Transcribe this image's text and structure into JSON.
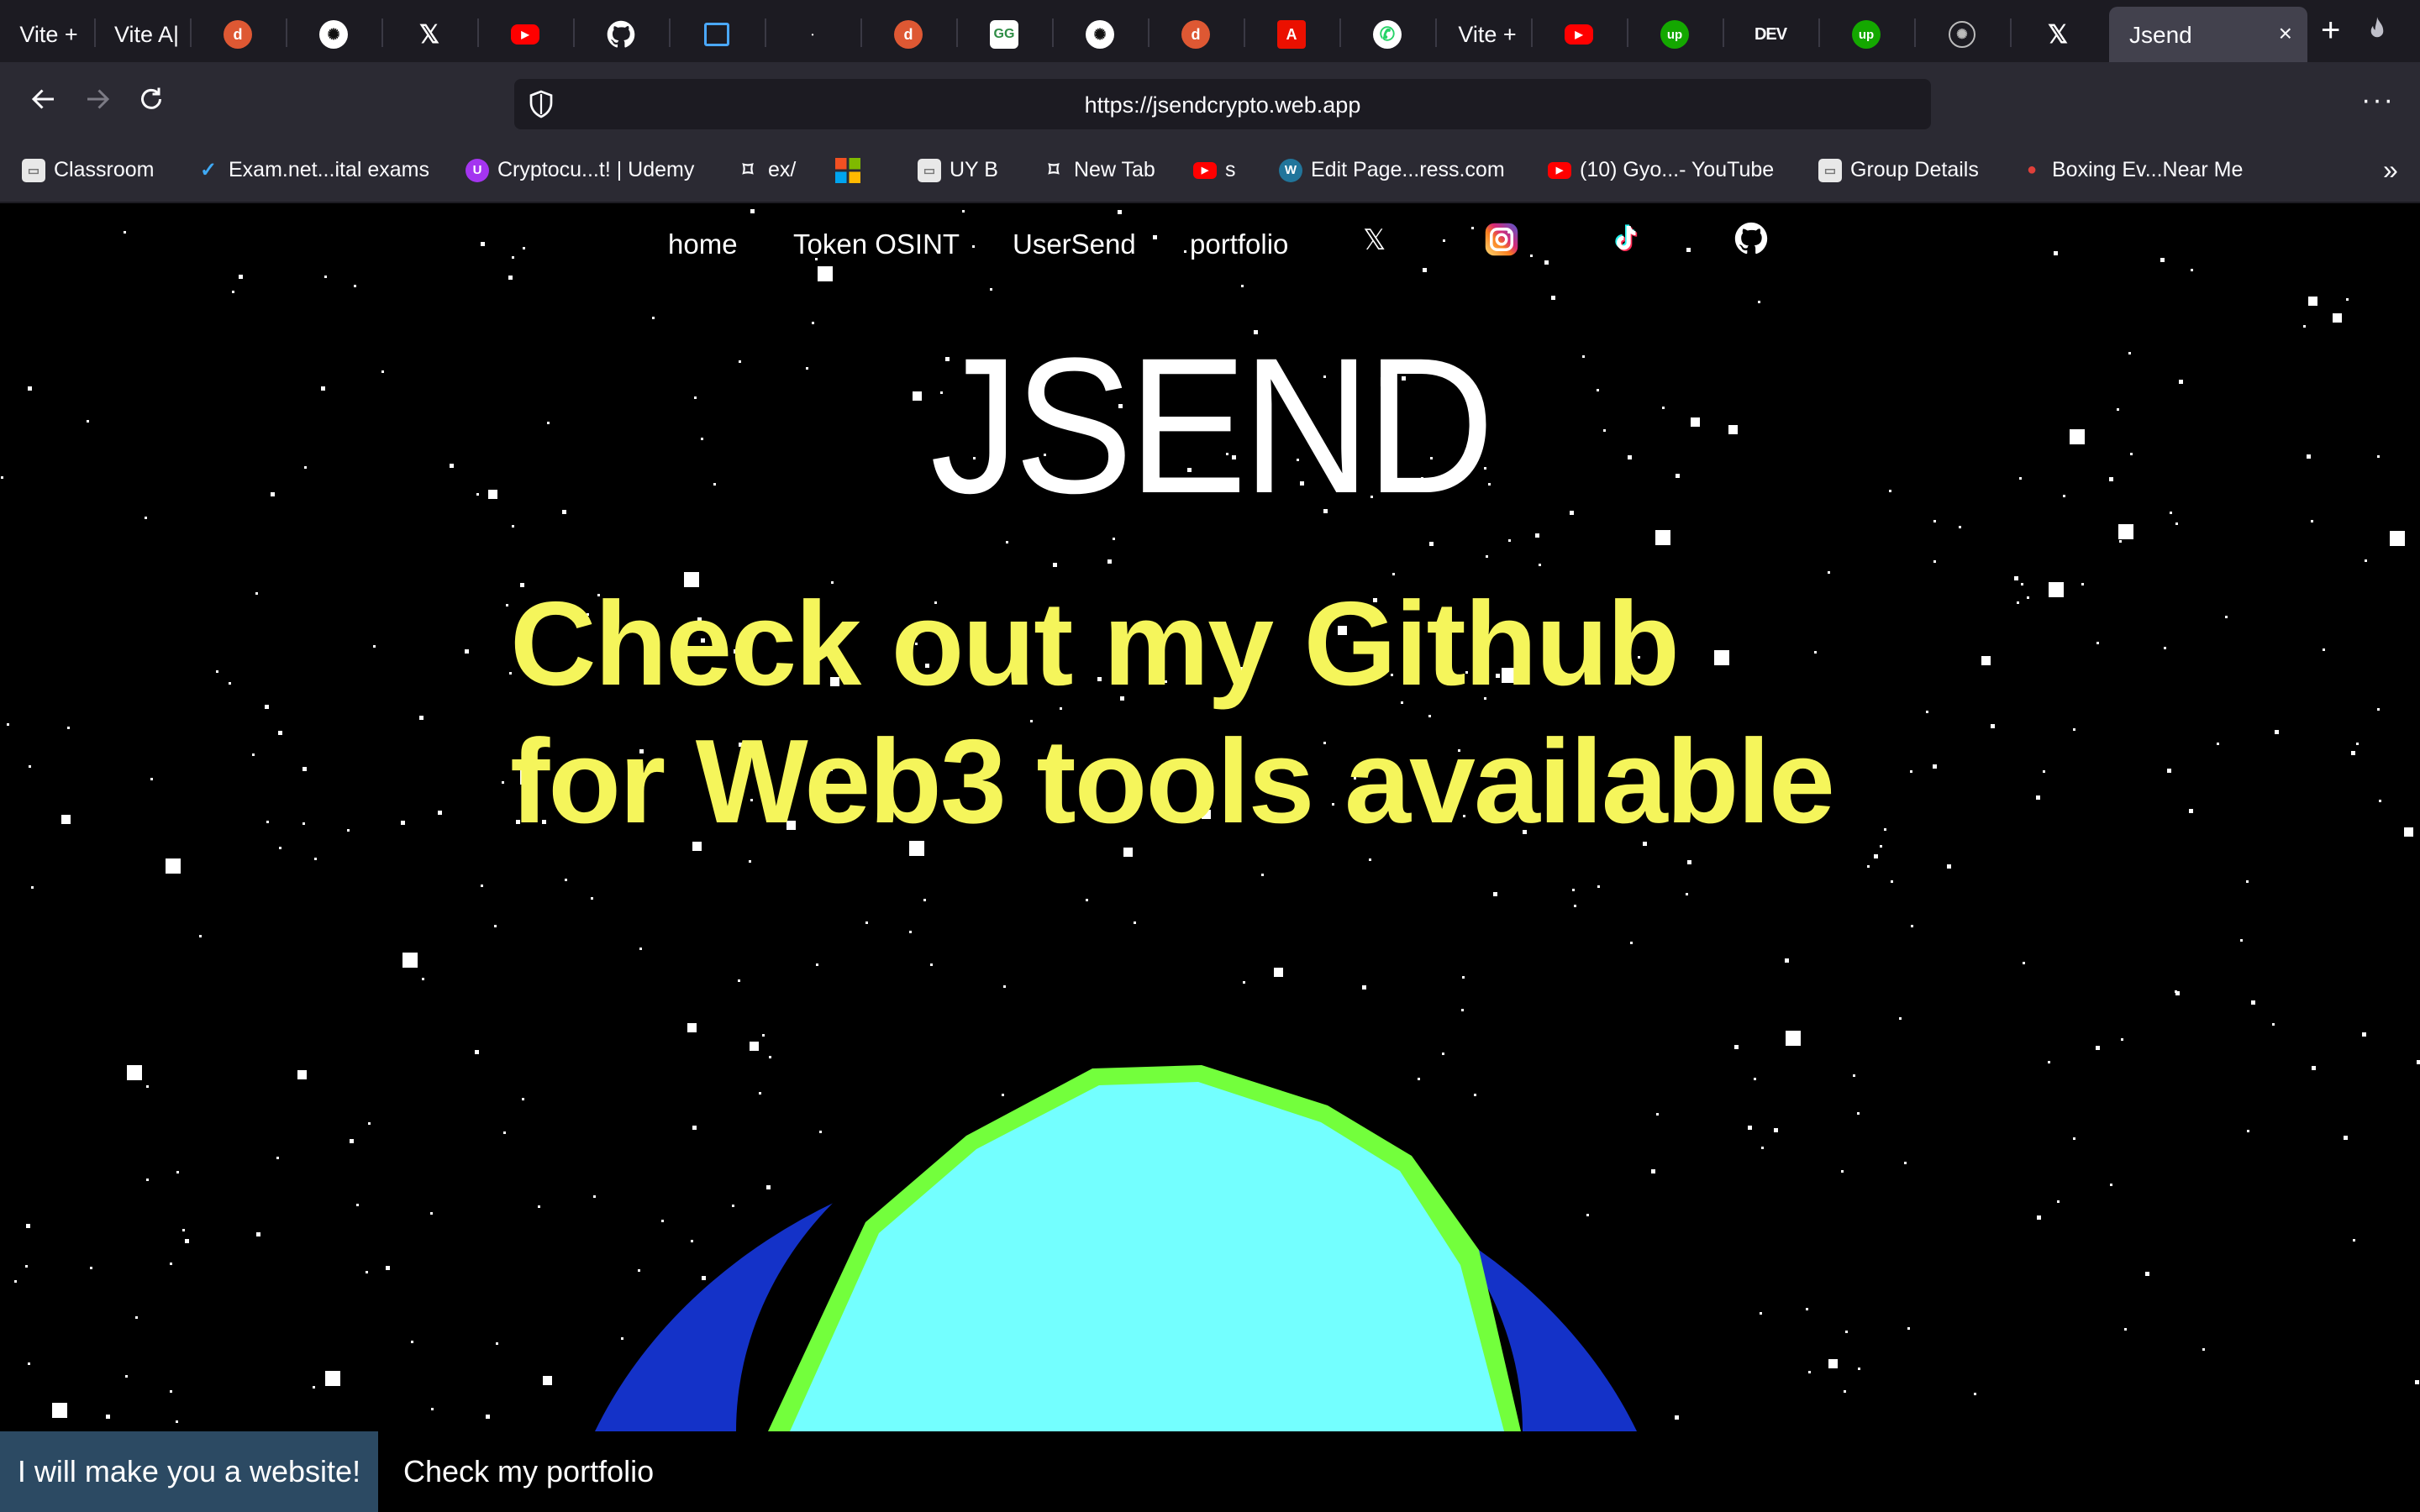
{
  "browser": {
    "tabs": [
      {
        "label": "Vite +",
        "icon": "vite-text"
      },
      {
        "label": "Vite A|",
        "icon": "vite-text"
      },
      {
        "label": "",
        "icon": "duckduckgo-icon"
      },
      {
        "label": "",
        "icon": "chatgpt-icon"
      },
      {
        "label": "",
        "icon": "x-icon"
      },
      {
        "label": "",
        "icon": "youtube-icon"
      },
      {
        "label": "",
        "icon": "github-icon"
      },
      {
        "label": "",
        "icon": "frame-icon"
      },
      {
        "label": "",
        "icon": "dot-icon"
      },
      {
        "label": "",
        "icon": "duckduckgo-icon"
      },
      {
        "label": "",
        "icon": "geeksforgeeks-icon"
      },
      {
        "label": "",
        "icon": "chatgpt-icon"
      },
      {
        "label": "",
        "icon": "duckduckgo-icon"
      },
      {
        "label": "",
        "icon": "adobe-icon"
      },
      {
        "label": "",
        "icon": "whatsapp-icon"
      },
      {
        "label": "Vite +",
        "icon": "vite-text"
      },
      {
        "label": "",
        "icon": "youtube-icon"
      },
      {
        "label": "",
        "icon": "upwork-icon"
      },
      {
        "label": "DEV",
        "icon": "dev-icon"
      },
      {
        "label": "",
        "icon": "upwork-icon"
      },
      {
        "label": "",
        "icon": "openai-icon"
      },
      {
        "label": "",
        "icon": "x-icon"
      }
    ],
    "active_tab": {
      "label": "Jsend",
      "close": "×"
    },
    "new_tab": "+",
    "url": "https://jsendcrypto.web.app",
    "menu": "···",
    "bookmarks": [
      {
        "label": "Classroom"
      },
      {
        "label": "Exam.net...ital exams"
      },
      {
        "label": "Cryptocu...t! | Udemy"
      },
      {
        "label": "ex/"
      },
      {
        "label": ""
      },
      {
        "label": "UY B"
      },
      {
        "label": "New Tab"
      },
      {
        "label": "s"
      },
      {
        "label": "Edit Page...ress.com"
      },
      {
        "label": "(10) Gyo...- YouTube"
      },
      {
        "label": "Group Details"
      },
      {
        "label": "Boxing Ev...Near Me"
      }
    ],
    "bookmarks_more": "»"
  },
  "site": {
    "nav": [
      "home",
      "Token OSINT",
      "UserSend",
      "portfolio"
    ],
    "brand": "JSEND",
    "headline_line1": "Check out my Github",
    "headline_line2": "for Web3 tools available",
    "cta_primary": "I will make you a website!",
    "cta_secondary": "Check my portfolio"
  },
  "colors": {
    "background": "#000000",
    "headline": "#f5f55b",
    "planet_ring": "#1432c8",
    "planet_inner_ring": "#73ff3c",
    "planet_core": "#73ffff",
    "cta_primary_bg": "#2c4a63"
  }
}
